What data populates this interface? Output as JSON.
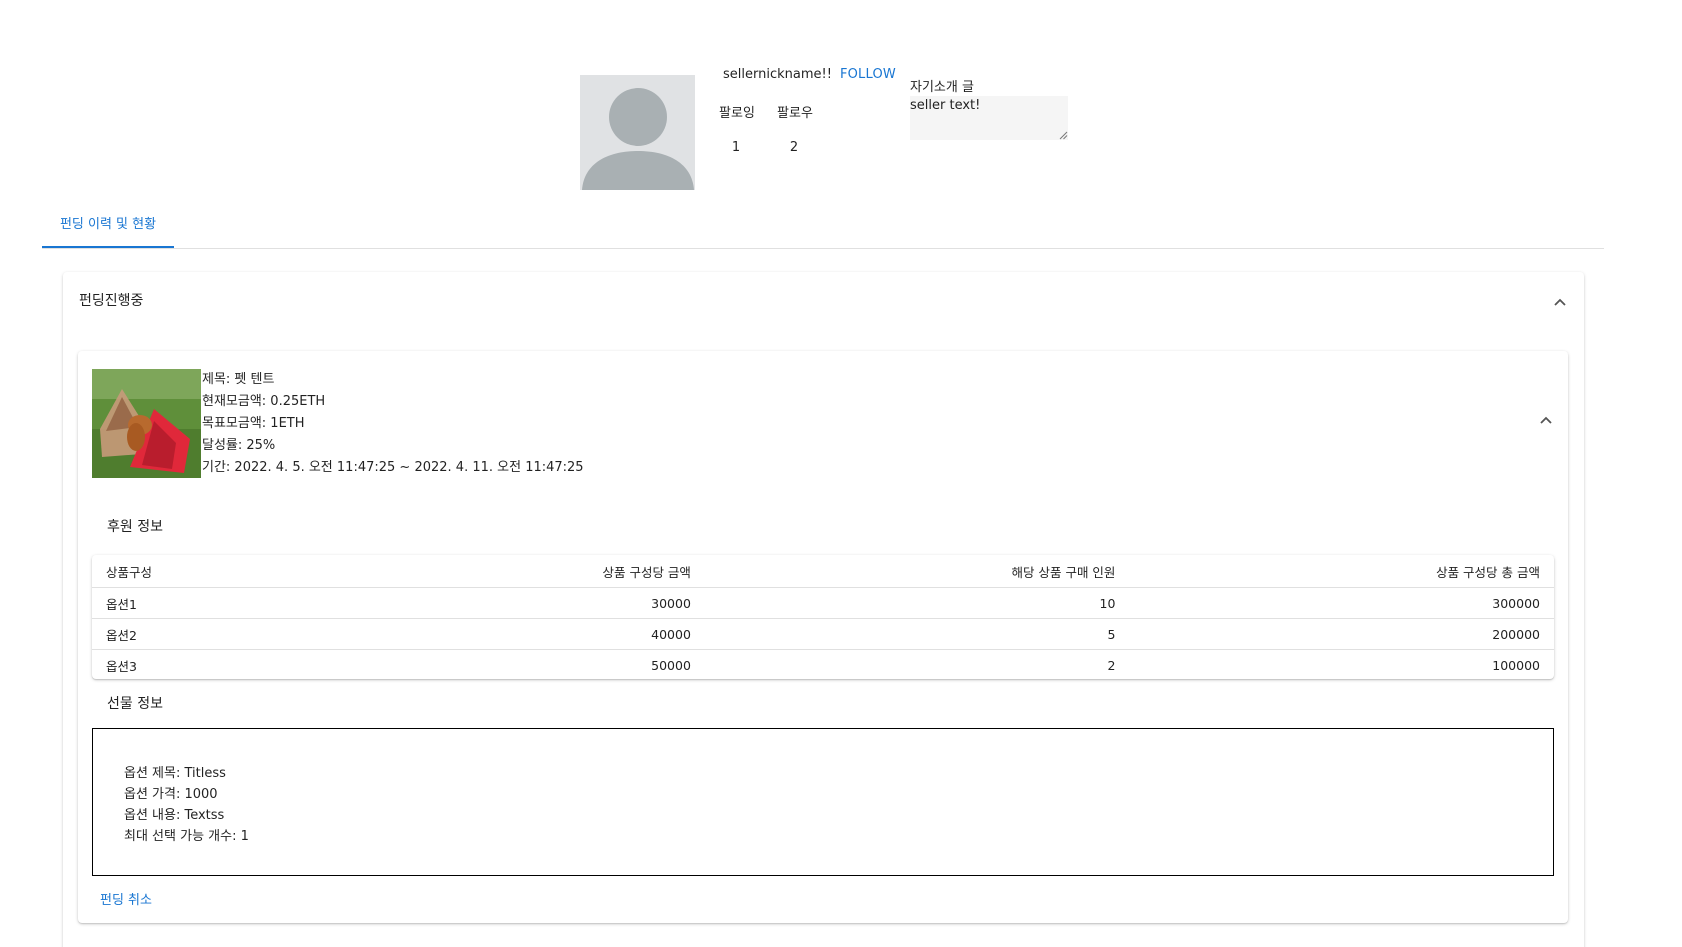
{
  "profile": {
    "nickname": "sellernickname!!",
    "follow_label": "FOLLOW",
    "following_label": "팔로잉",
    "follower_label": "팔로우",
    "following_count": "1",
    "follower_count": "2",
    "intro_label": "자기소개 글",
    "intro_text": "seller text!"
  },
  "tabs": [
    {
      "label": "펀딩 이력 및 현황",
      "selected": true
    }
  ],
  "funding_section": {
    "title": "펀딩진행중",
    "item": {
      "title": "제목: 펫 텐트",
      "current_amount": "현재모금액: 0.25ETH",
      "target_amount": "목표모금액: 1ETH",
      "achievement": "달성률: 25%",
      "period": "기간: 2022. 4. 5. 오전 11:47:25 ~ 2022. 4. 11. 오전 11:47:25",
      "sponsor_title": "후원 정보",
      "table": {
        "headers": [
          "상품구성",
          "상품 구성당 금액",
          "해당 상품 구매 인원",
          "상품 구성당 총 금액"
        ],
        "rows": [
          [
            "옵션1",
            "30000",
            "10",
            "300000"
          ],
          [
            "옵션2",
            "40000",
            "5",
            "200000"
          ],
          [
            "옵션3",
            "50000",
            "2",
            "100000"
          ]
        ]
      },
      "gift_title": "선물 정보",
      "gift": {
        "option_title": "옵션 제목: Titless",
        "option_price": "옵션 가격: 1000",
        "option_content": "옵션 내용: Textss",
        "max_select": "최대 선택 가능 개수: 1"
      },
      "cancel_label": "펀딩 취소"
    }
  },
  "colors": {
    "accent": "#1976d2",
    "avatar_bg": "#e0e2e4",
    "avatar_fg": "#a9b0b3"
  }
}
